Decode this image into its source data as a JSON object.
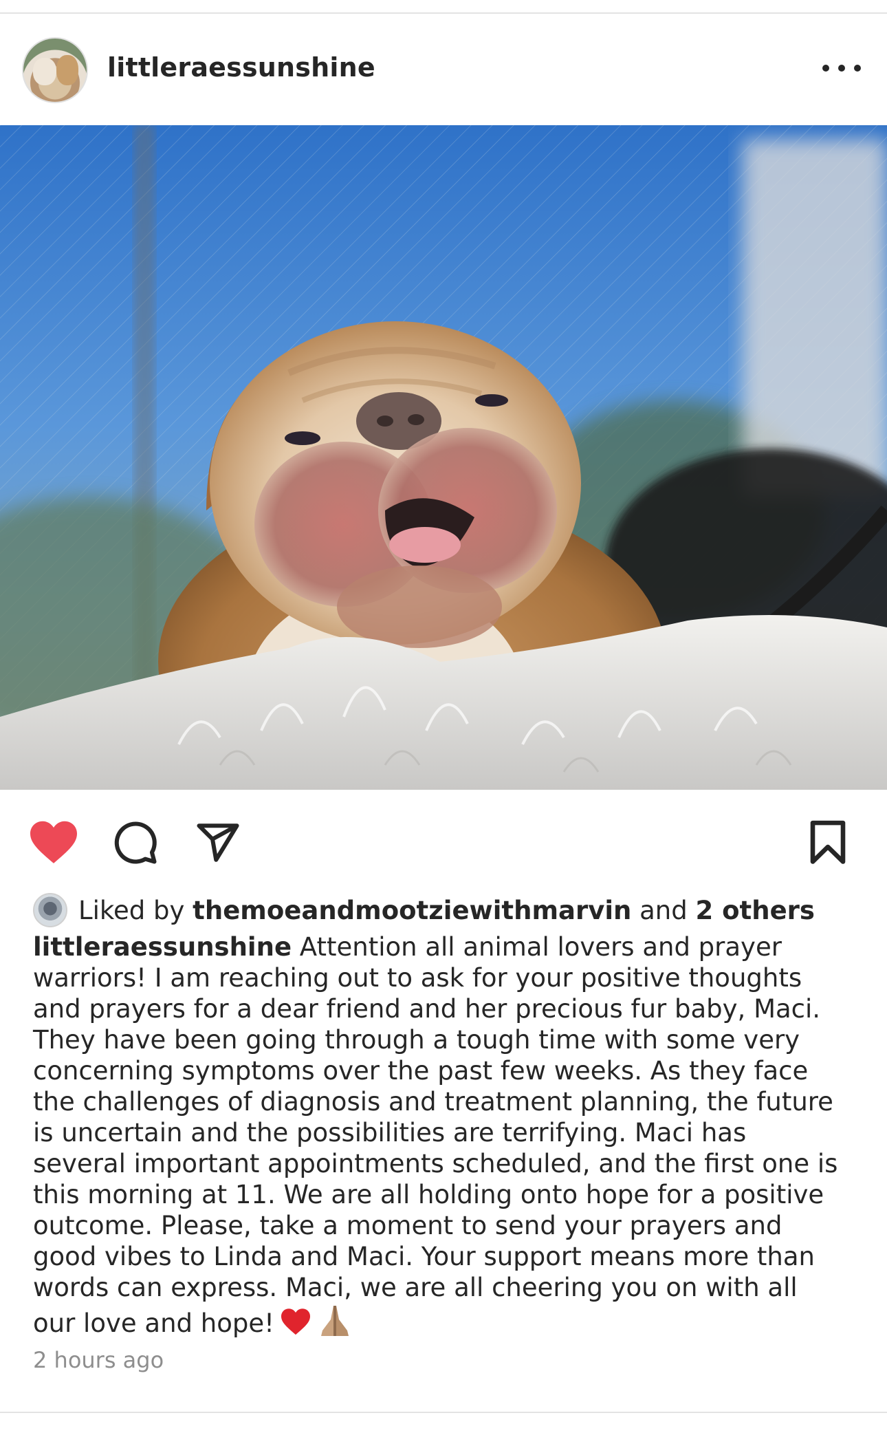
{
  "post": {
    "username": "littleraessunshine",
    "avatar_icon": "profile-avatar-two-bulldogs",
    "more_icon": "more-horizontal-icon",
    "photo_description_icon": "bulldog-photo",
    "actions": {
      "like_icon": "heart-filled-icon",
      "comment_icon": "comment-icon",
      "share_icon": "send-icon",
      "save_icon": "bookmark-icon",
      "like_color": "#ed4956"
    },
    "likes": {
      "prefix": "Liked by",
      "liker": "themoeandmootziewithmarvin",
      "connector": "and",
      "others": "2 others"
    },
    "caption": {
      "username": "littleraessunshine",
      "lines": [
        " Attention all animal lovers and prayer",
        "warriors! I am reaching out to ask for your positive thoughts",
        "and prayers for a dear friend and her precious fur baby, Maci.",
        "They have been going through a tough time with some very",
        "concerning symptoms over the past few weeks. As they face",
        "the challenges of diagnosis and treatment planning, the future",
        "is uncertain and the possibilities are terrifying. Maci has",
        "several important appointments scheduled, and the first one is",
        "this morning at 11. We are all holding onto hope for a positive",
        "outcome. Please, take a moment to send your prayers and",
        "good vibes to Linda and Maci. Your support means more than",
        "words can express. Maci, we are all cheering you on with all",
        "our love and hope!"
      ],
      "emoji_icons": [
        "red-heart-emoji",
        "folded-hands-emoji"
      ]
    },
    "timestamp": "2 hours ago"
  }
}
